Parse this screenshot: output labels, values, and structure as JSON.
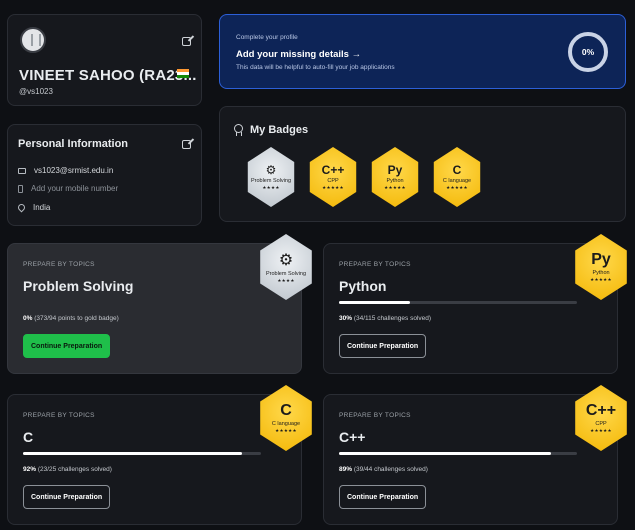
{
  "profile": {
    "name": "VINEET SAHOO (RA23...",
    "handle": "@vs1023"
  },
  "personal_info": {
    "title": "Personal Information",
    "email": "vs1023@srmist.edu.in",
    "phone_placeholder": "Add your mobile number",
    "country": "India"
  },
  "profile_completion": {
    "small_label": "Complete your profile",
    "headline": "Add your missing details →",
    "subtext": "This data will be helpful to auto-fill your job applications",
    "percent": "0%"
  },
  "badges": {
    "title": "My Badges",
    "items": [
      {
        "symbol": "⚙",
        "label": "Problem Solving",
        "stars": "★★★★",
        "tier": "silver"
      },
      {
        "symbol": "C++",
        "label": "CPP",
        "stars": "★★★★★",
        "tier": "gold"
      },
      {
        "symbol": "Py",
        "label": "Python",
        "stars": "★★★★★",
        "tier": "gold"
      },
      {
        "symbol": "C",
        "label": "C language",
        "stars": "★★★★★",
        "tier": "gold"
      }
    ]
  },
  "topics": [
    {
      "tag": "PREPARE BY TOPICS",
      "name": "Problem Solving",
      "progress_bold": "0%",
      "progress_text": "(373/94 points to gold badge)",
      "progress": 0,
      "button": "Continue Preparation",
      "badge_symbol": "⚙",
      "badge_label": "Problem Solving",
      "badge_stars": "★★★★"
    },
    {
      "tag": "PREPARE BY TOPICS",
      "name": "Python",
      "progress_bold": "30%",
      "progress_text": "(34/115 challenges solved)",
      "progress": 0.3,
      "button": "Continue Preparation",
      "badge_symbol": "Py",
      "badge_label": "Python",
      "badge_stars": "★★★★★"
    },
    {
      "tag": "PREPARE BY TOPICS",
      "name": "C",
      "progress_bold": "92%",
      "progress_text": "(23/25 challenges solved)",
      "progress": 0.92,
      "button": "Continue Preparation",
      "badge_symbol": "C",
      "badge_label": "C language",
      "badge_stars": "★★★★★"
    },
    {
      "tag": "PREPARE BY TOPICS",
      "name": "C++",
      "progress_bold": "89%",
      "progress_text": "(39/44 challenges solved)",
      "progress": 0.89,
      "button": "Continue Preparation",
      "badge_symbol": "C++",
      "badge_label": "CPP",
      "badge_stars": "★★★★★"
    }
  ],
  "colors": {
    "accent_blue": "#0d2457",
    "gold_badge": "#f2b400",
    "green_button": "#1fbf4a"
  }
}
